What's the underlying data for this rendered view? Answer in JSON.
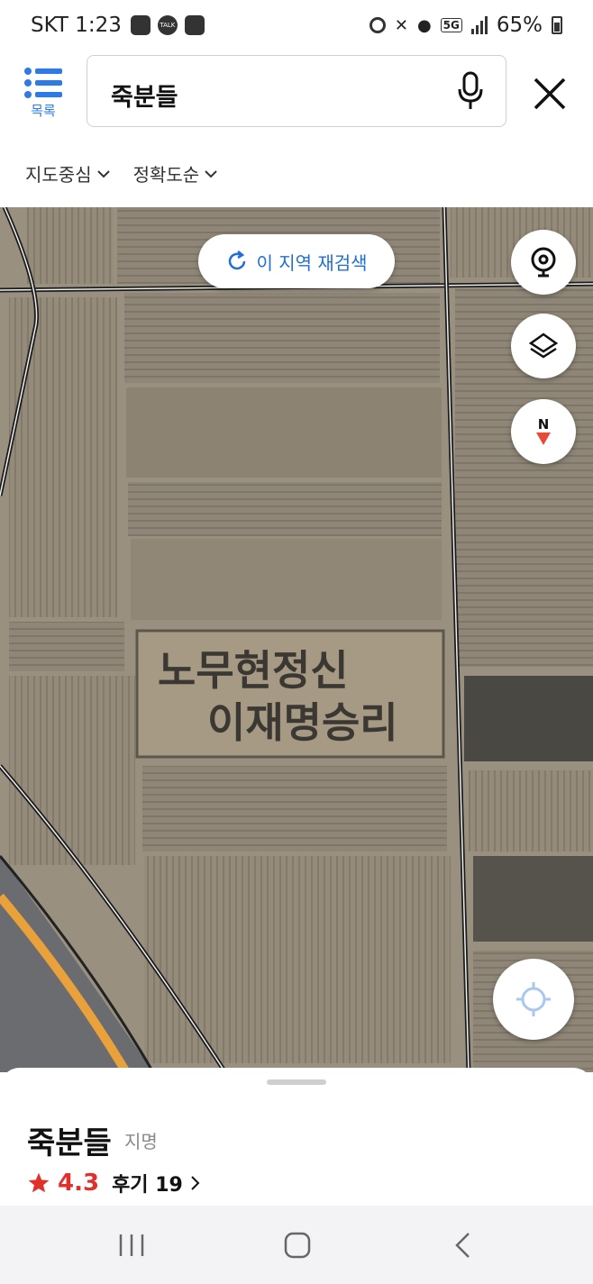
{
  "status_bar": {
    "carrier_time": "SKT 1:23",
    "talk_icon_text": "TALK",
    "network": "5G",
    "battery": "65%"
  },
  "header": {
    "list_label": "목록",
    "search_value": "죽분들",
    "filters": [
      "지도중심",
      "정확도순"
    ]
  },
  "map": {
    "research_label": "이 지역 재검색",
    "compass_label": "N",
    "field_text_line1": "노무현정신",
    "field_text_line2": "이재명승리"
  },
  "place": {
    "name": "죽분들",
    "type": "지명",
    "rating": "4.3",
    "reviews_label": "후기 19"
  },
  "colors": {
    "accent_blue": "#1f6fd6",
    "rating_red": "#e0302c",
    "compass_red": "#e84a3a"
  },
  "icons": [
    "list-icon",
    "mic-icon",
    "close-icon",
    "refresh-icon",
    "cctv-icon",
    "layers-icon",
    "compass-icon",
    "my-location-icon",
    "star-icon",
    "chevron-right-icon"
  ]
}
